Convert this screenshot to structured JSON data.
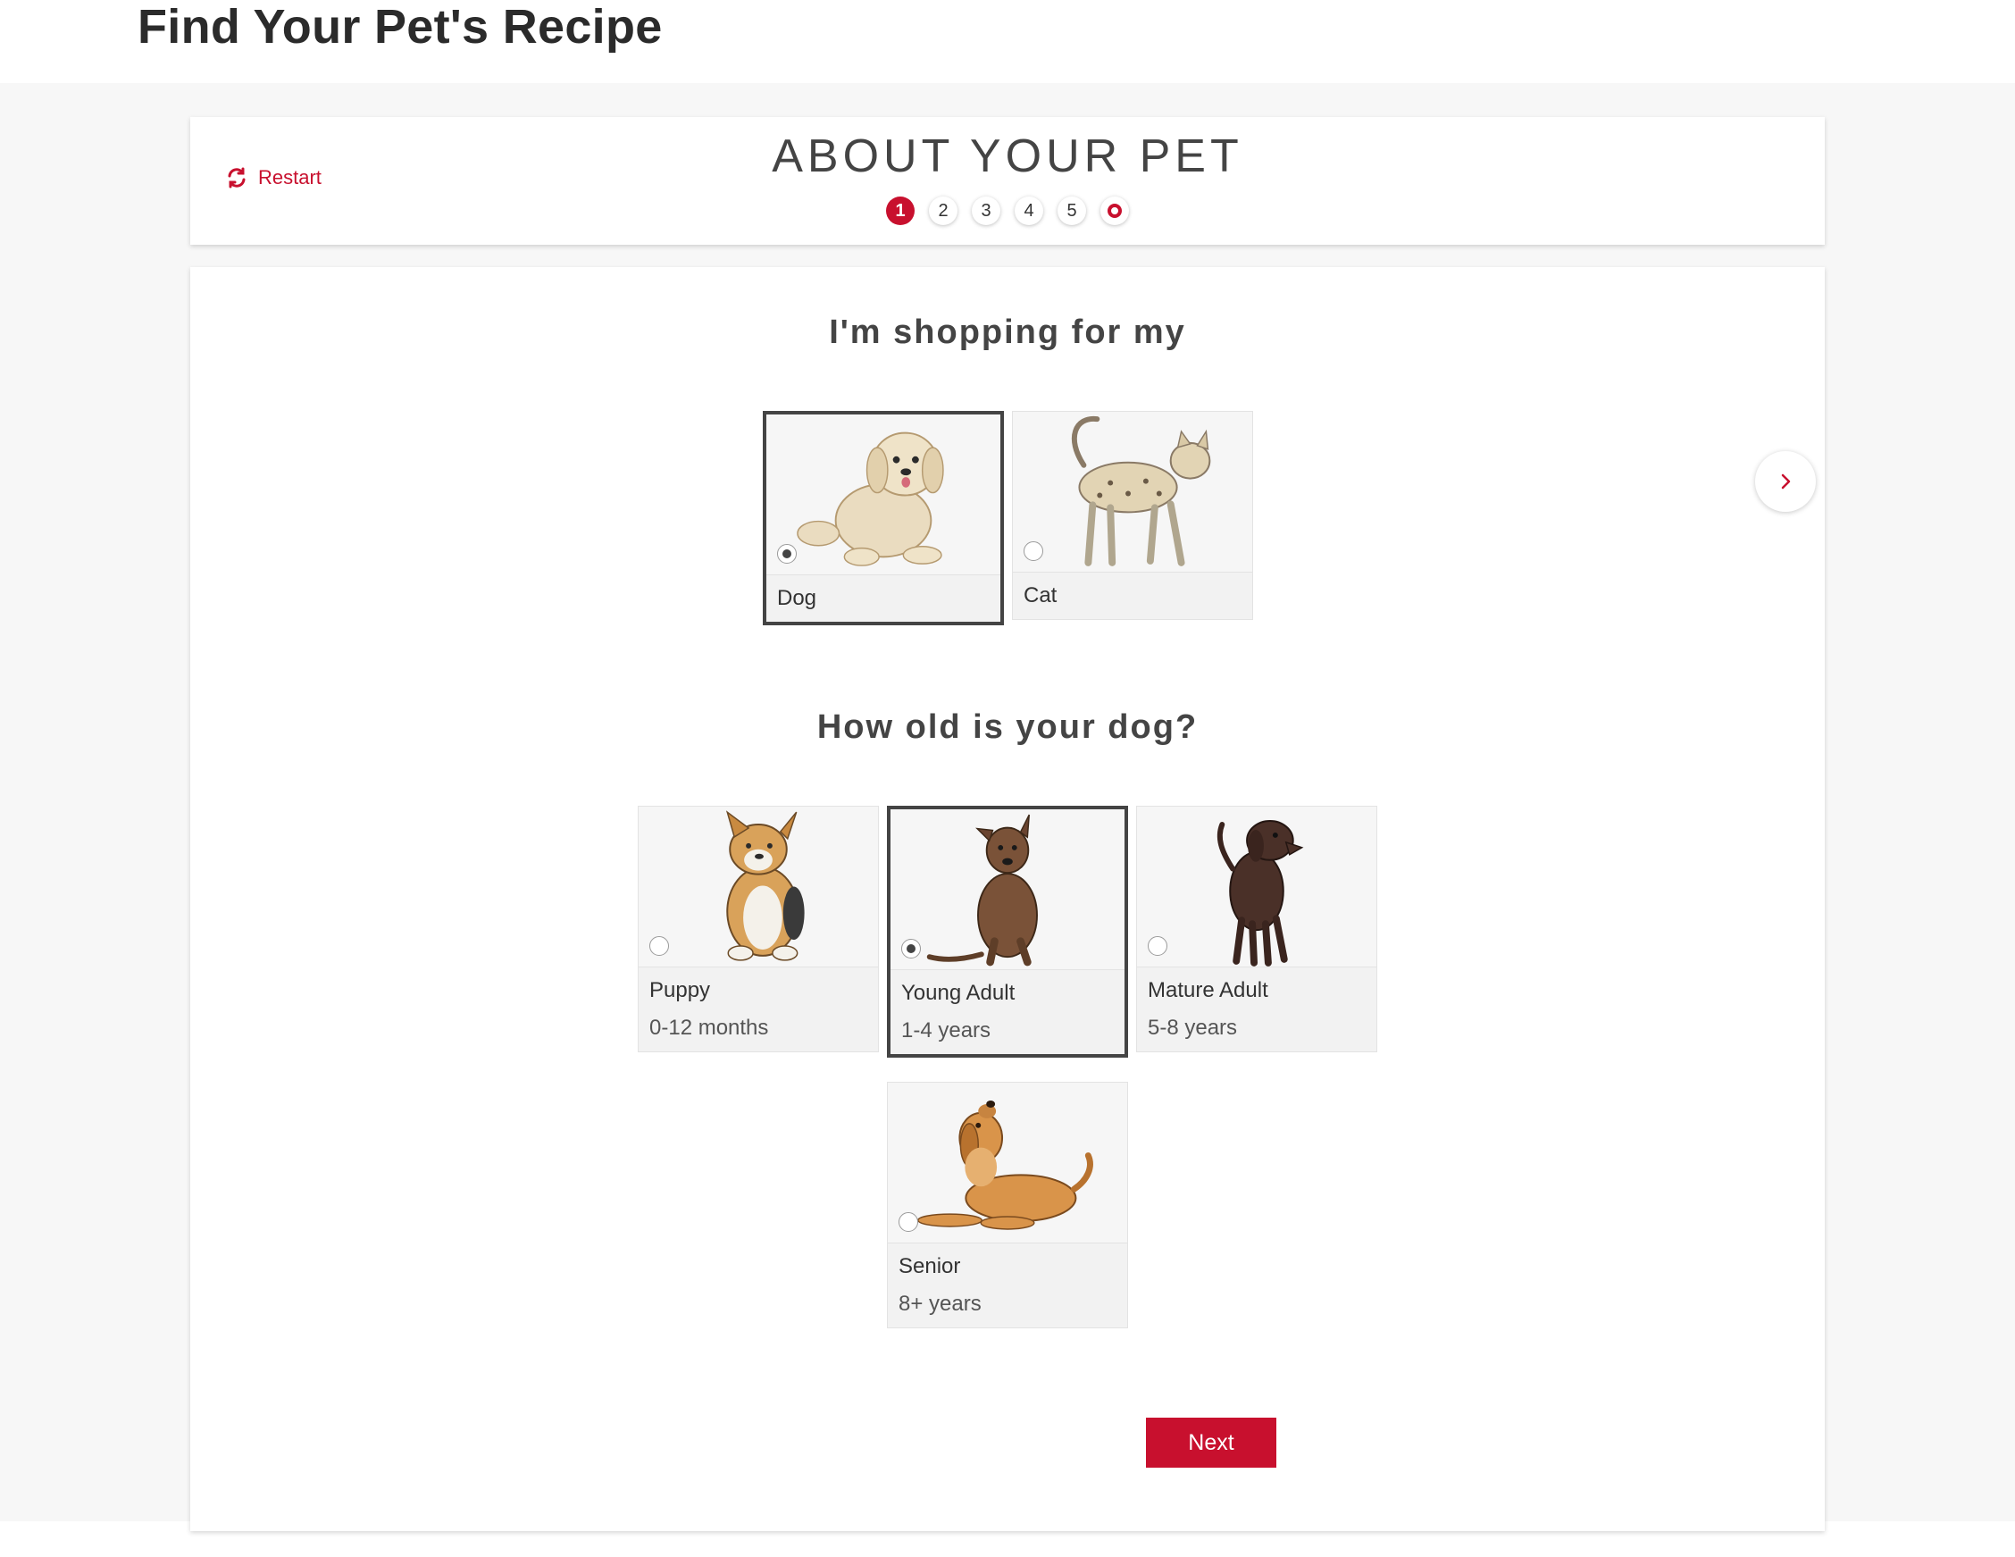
{
  "page": {
    "title": "Find Your Pet's Recipe"
  },
  "stepper": {
    "restart_label": "Restart",
    "title": "ABOUT YOUR PET",
    "steps": [
      "1",
      "2",
      "3",
      "4",
      "5"
    ],
    "current_step": 1
  },
  "pet_question": {
    "title": "I'm shopping for my",
    "options": [
      {
        "label": "Dog",
        "selected": true,
        "icon": "dog-illustration"
      },
      {
        "label": "Cat",
        "selected": false,
        "icon": "cat-illustration"
      }
    ]
  },
  "age_question": {
    "title": "How old is your dog?",
    "options": [
      {
        "label": "Puppy",
        "sub": "0-12 months",
        "selected": false
      },
      {
        "label": "Young Adult",
        "sub": "1-4 years",
        "selected": true
      },
      {
        "label": "Mature Adult",
        "sub": "5-8 years",
        "selected": false
      },
      {
        "label": "Senior",
        "sub": "8+ years",
        "selected": false
      }
    ]
  },
  "actions": {
    "next_label": "Next"
  },
  "colors": {
    "accent": "#c8102e",
    "selected_border": "#444444",
    "background": "#f7f7f7"
  },
  "icons": {
    "restart": "refresh-icon",
    "carousel_next": "chevron-right-icon"
  }
}
